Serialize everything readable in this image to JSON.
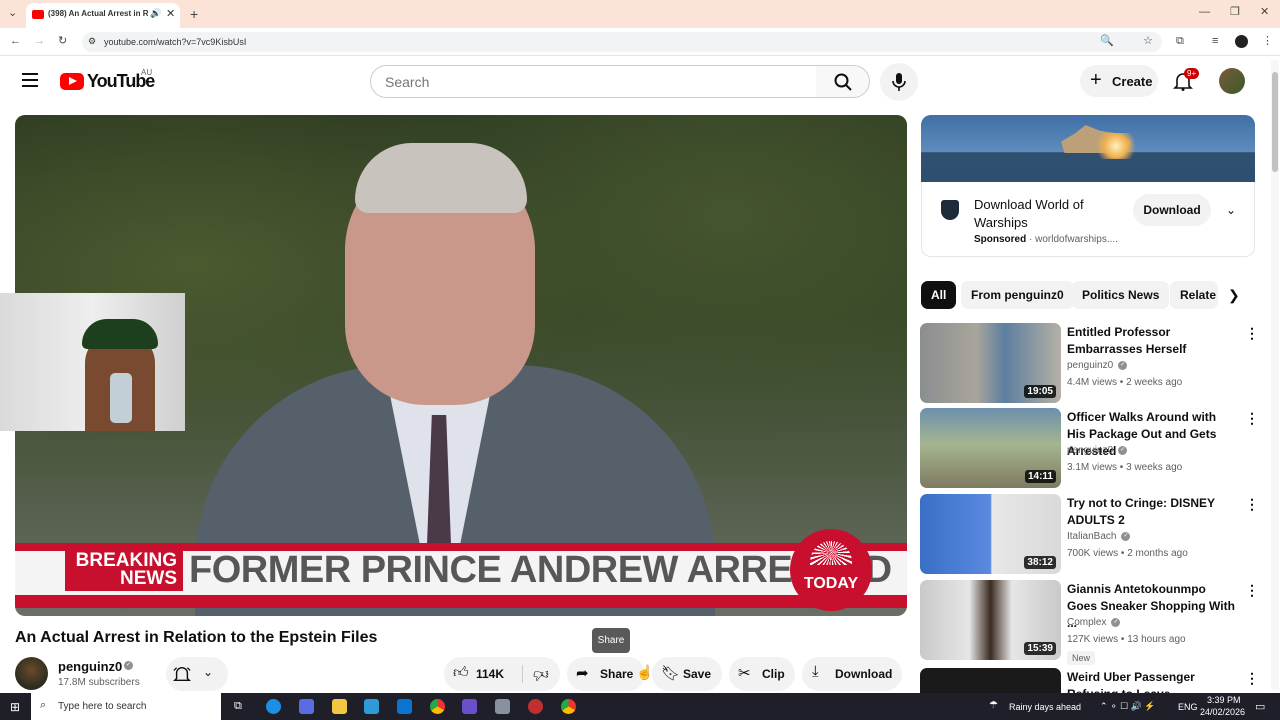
{
  "browser": {
    "tab_title": "(398) An Actual Arrest in Re",
    "url": "youtube.com/watch?v=7vc9KisbUsI"
  },
  "header": {
    "logo_text": "YouTube",
    "region": "AU",
    "search_placeholder": "Search",
    "create_label": "Create",
    "notif_count": "9+"
  },
  "video": {
    "breaking_label": "BREAKING NEWS",
    "headline": "FORMER PRINCE ANDREW ARRESTED",
    "network_logo": "TODAY",
    "title": "An Actual Arrest in Relation to the Epstein Files",
    "tooltip": "Share"
  },
  "channel": {
    "name": "penguinz0",
    "subscribers": "17.8M subscribers"
  },
  "actions": {
    "likes": "114K",
    "share": "Share",
    "save": "Save",
    "clip": "Clip",
    "download": "Download"
  },
  "ad": {
    "title": "Download World of Warships",
    "sponsored": "Sponsored",
    "domain": "worldofwarships....",
    "button": "Download"
  },
  "chips": [
    "All",
    "From penguinz0",
    "Politics News",
    "Relate"
  ],
  "recommendations": [
    {
      "title": "Entitled Professor Embarrasses Herself",
      "channel": "penguinz0",
      "views": "4.4M views • 2 weeks ago",
      "duration": "19:05"
    },
    {
      "title": "Officer Walks Around with His Package Out and Gets Arrested",
      "channel": "penguinz0",
      "views": "3.1M views • 3 weeks ago",
      "duration": "14:11"
    },
    {
      "title": "Try not to Cringe: DISNEY ADULTS 2",
      "channel": "ItalianBach",
      "views": "700K views • 2 months ago",
      "duration": "38:12"
    },
    {
      "title": "Giannis Antetokounmpo Goes Sneaker Shopping With ...",
      "channel": "Complex",
      "views": "127K views • 13 hours ago",
      "duration": "15:39",
      "badge": "New"
    },
    {
      "title": "Weird Uber Passenger Refusing to Leave",
      "channel": "",
      "views": "",
      "duration": ""
    }
  ],
  "taskbar": {
    "search_placeholder": "Type here to search",
    "weather": "Rainy days ahead",
    "lang": "ENG",
    "time": "3:39 PM",
    "date": "24/02/2026"
  }
}
